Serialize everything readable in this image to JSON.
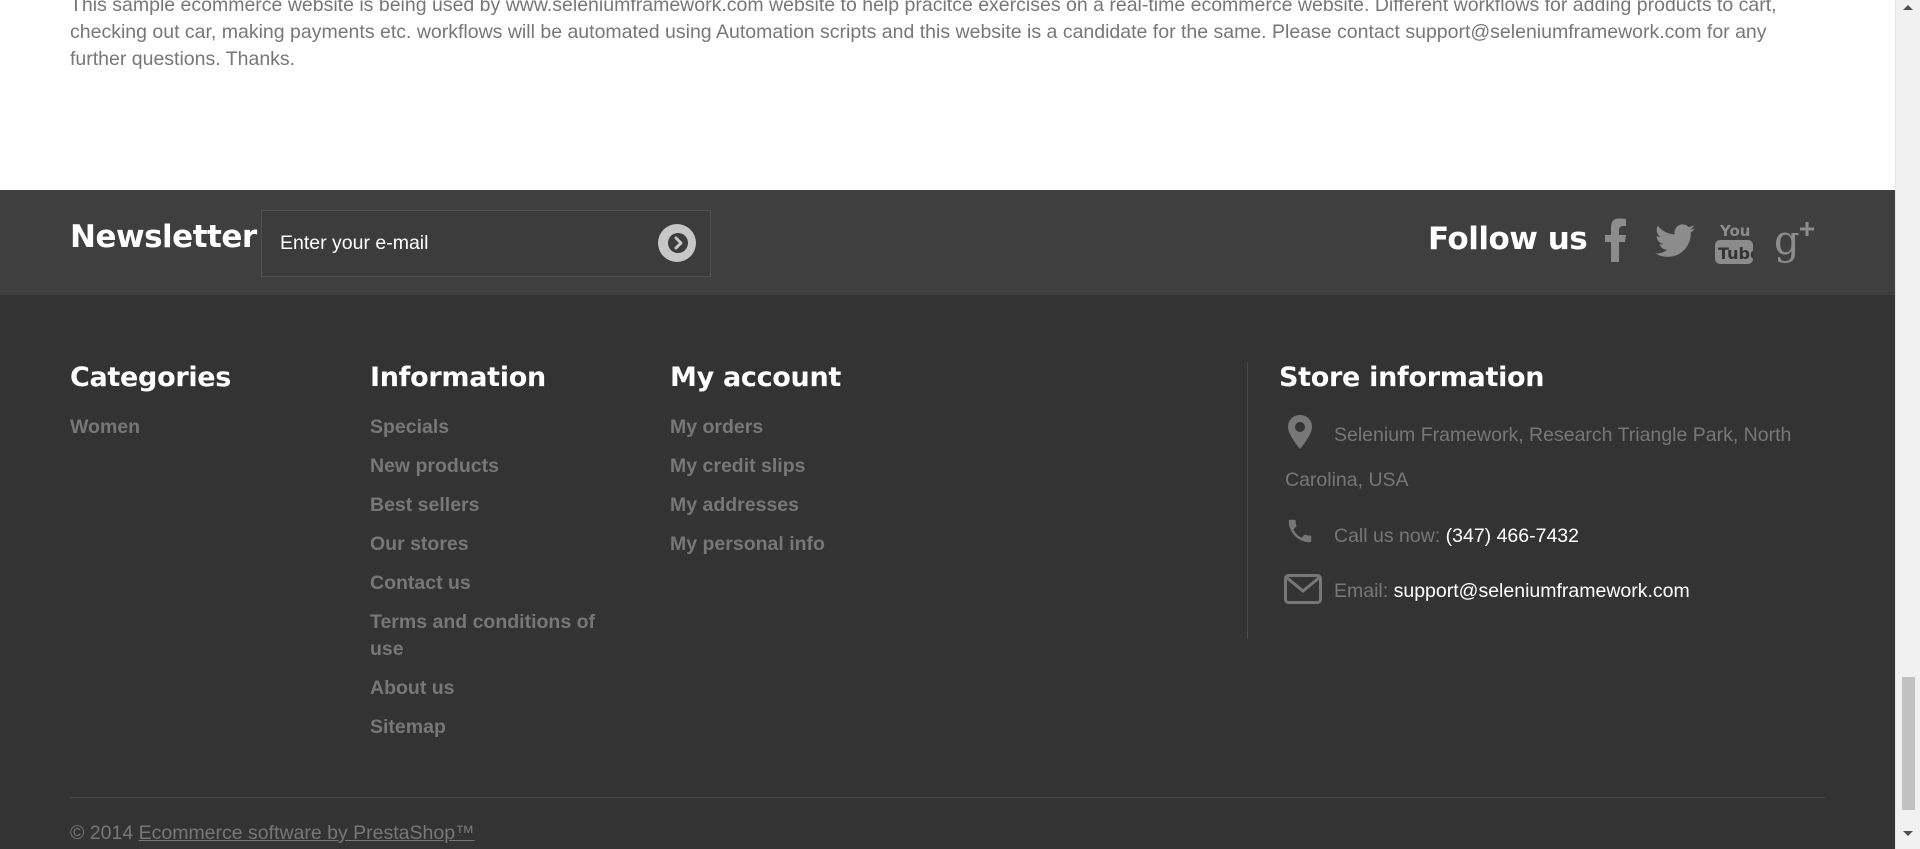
{
  "intro": {
    "text": "This sample ecommerce website is being used by www.seleniumframework.com website to help pracitce exercises on a real-time ecommerce website. Different workflows for adding products to cart, checking out car, making payments etc. workflows will be automated using Automation scripts and this website is a candidate for the same. Please contact support@seleniumframework.com for any further questions. Thanks."
  },
  "newsletter": {
    "title": "Newsletter",
    "placeholder": "Enter your e-mail",
    "submit_icon": "chevron-right-icon"
  },
  "follow": {
    "title": "Follow us",
    "networks": [
      "facebook-icon",
      "twitter-icon",
      "youtube-icon",
      "google-plus-icon"
    ]
  },
  "footer": {
    "categories": {
      "title": "Categories",
      "items": [
        "Women"
      ]
    },
    "information": {
      "title": "Information",
      "items": [
        "Specials",
        "New products",
        "Best sellers",
        "Our stores",
        "Contact us",
        "Terms and conditions of use",
        "About us",
        "Sitemap"
      ]
    },
    "account": {
      "title": "My account",
      "items": [
        "My orders",
        "My credit slips",
        "My addresses",
        "My personal info"
      ]
    },
    "store": {
      "title": "Store information",
      "address_line1": "Selenium Framework, Research Triangle Park, North",
      "address_line2": "Carolina, USA",
      "phone_label": "Call us now: ",
      "phone_value": "(347) 466-7432",
      "email_label": "Email: ",
      "email_value": "support@seleniumframework.com"
    },
    "copyright": {
      "prefix": "© 2014 ",
      "link": "Ecommerce software by PrestaShop™"
    }
  },
  "colors": {
    "newsletter_bg": "#3f3f3f",
    "footer_bg": "#333333",
    "link_gray": "#777777",
    "heading_white": "#ffffff"
  }
}
